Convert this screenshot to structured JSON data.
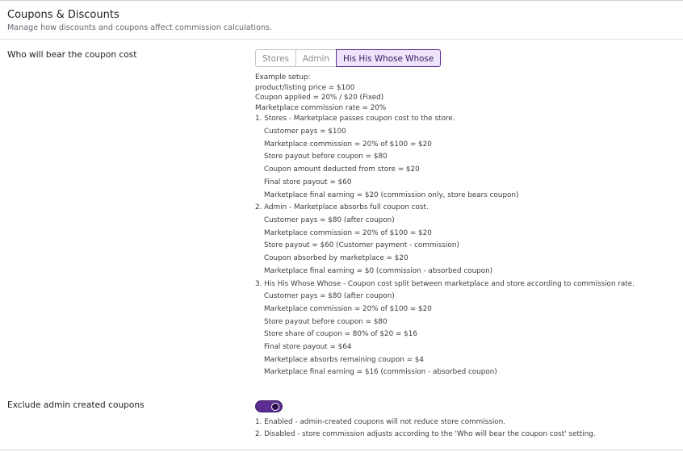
{
  "header": {
    "title": "Coupons & Discounts",
    "subtitle": "Manage how discounts and coupons affect commission calculations."
  },
  "coupon_cost": {
    "label": "Who will bear the coupon cost",
    "options": [
      "Stores",
      "Admin",
      "His His Whose Whose"
    ],
    "selected": "His His Whose Whose",
    "example_heading": "Example setup:",
    "example_lines": [
      "product/listing price = $100",
      "Coupon applied = 20% / $20 (Fixed)",
      "Marketplace commission rate = 20%"
    ],
    "cases": [
      {
        "title": "1. Stores - Marketplace passes coupon cost to the store.",
        "lines": [
          "Customer pays = $100",
          "Marketplace commission = 20% of $100 = $20",
          "Store payout before coupon = $80",
          "Coupon amount deducted from store = $20",
          "Final store payout = $60",
          "Marketplace final earning = $20 (commission only, store bears coupon)"
        ]
      },
      {
        "title": "2. Admin - Marketplace absorbs full coupon cost.",
        "lines": [
          "Customer pays = $80 (after coupon)",
          "Marketplace commission = 20% of $100 = $20",
          "Store payout = $60 (Customer payment - commission)",
          "Coupon absorbed by marketplace = $20",
          "Marketplace final earning = $0 (commission - absorbed coupon)"
        ]
      },
      {
        "title": "3. His His Whose Whose - Coupon cost split between marketplace and store according to commission rate.",
        "lines": [
          "Customer pays = $80 (after coupon)",
          "Marketplace commission = 20% of $100 = $20",
          "Store payout before coupon = $80",
          "Store share of coupon = 80% of $20 = $16",
          "Final store payout = $64",
          "Marketplace absorbs remaining coupon = $4",
          "Marketplace final earning = $16 (commission - absorbed coupon)"
        ]
      }
    ]
  },
  "exclude_admin": {
    "label": "Exclude admin created coupons",
    "enabled": true,
    "notes": [
      "1. Enabled - admin-created coupons will not reduce store commission.",
      "2. Disabled - store commission adjusts according to the 'Who will bear the coupon cost' setting."
    ]
  },
  "colors": {
    "accent": "#5b2c91",
    "accent_bg": "#ede3fa"
  }
}
